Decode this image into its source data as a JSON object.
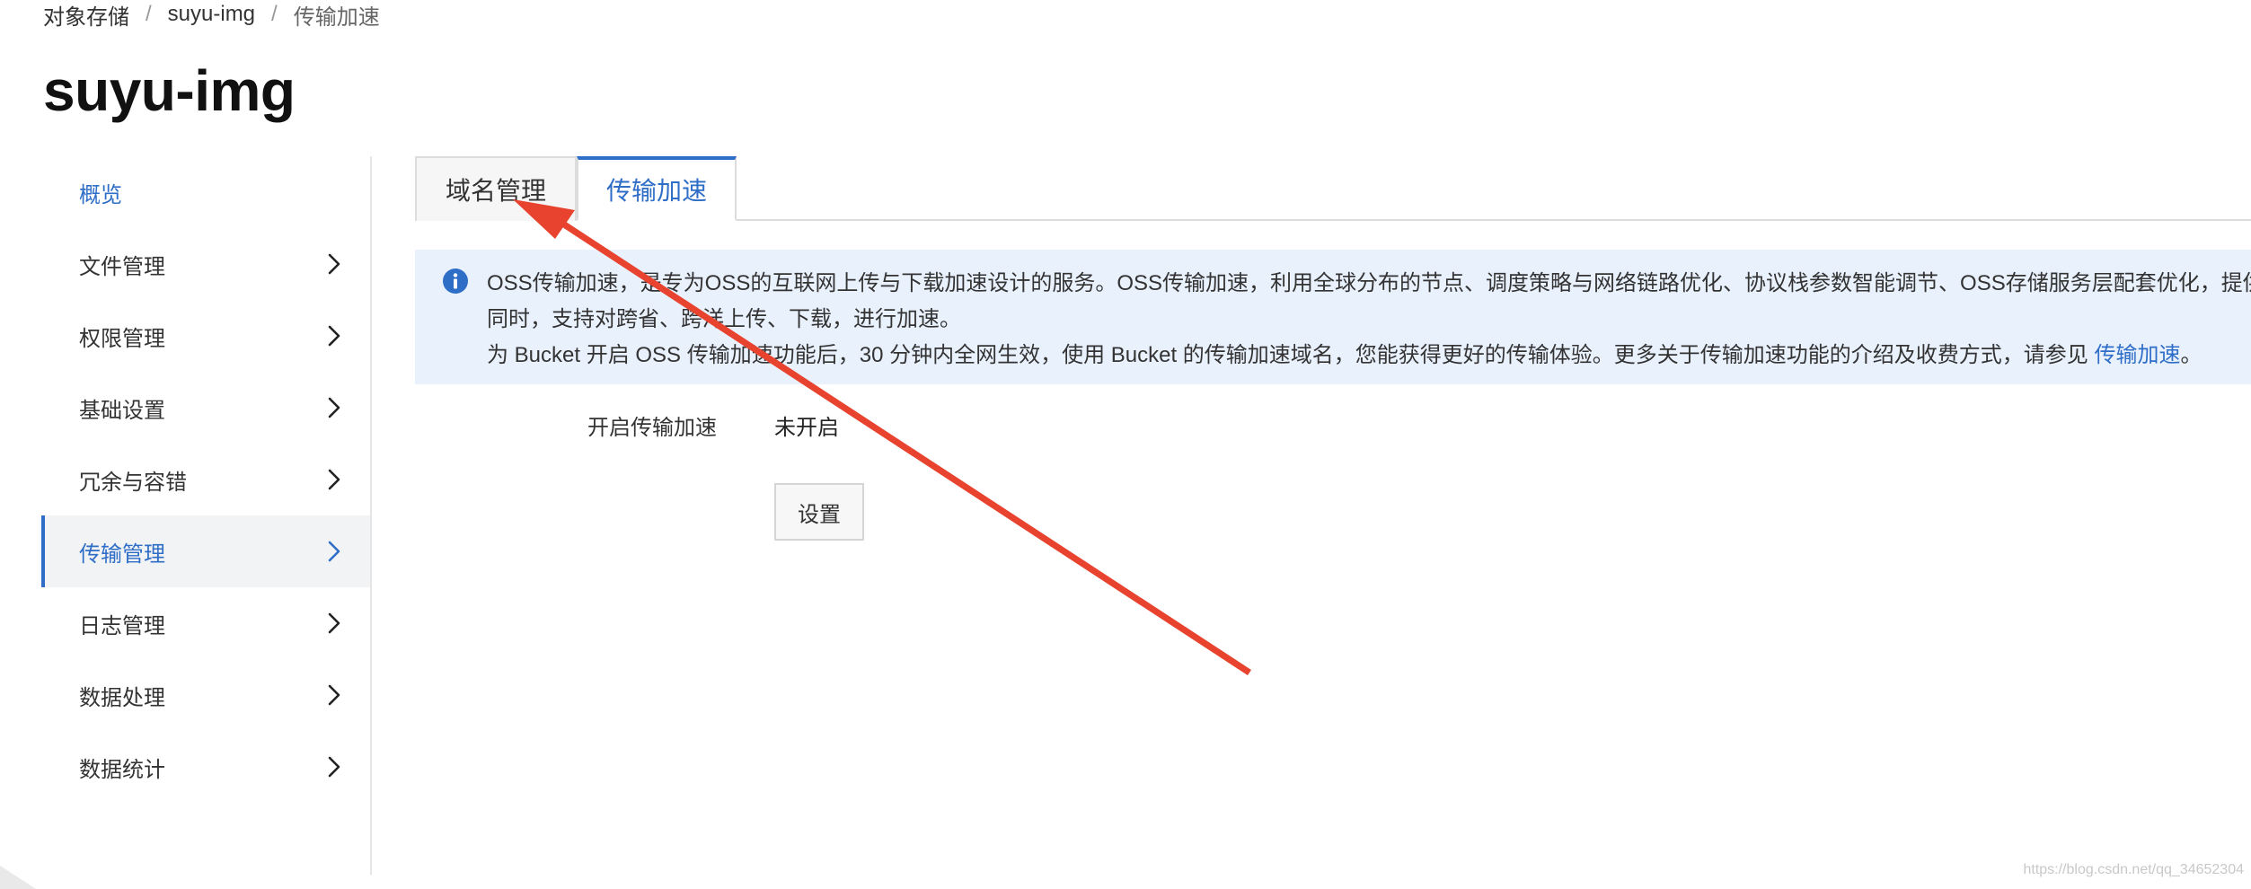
{
  "breadcrumb": {
    "items": [
      "对象存储",
      "suyu-img",
      "传输加速"
    ],
    "separator": "/"
  },
  "page_title": "suyu-img",
  "sidebar": {
    "items": [
      {
        "label": "概览"
      },
      {
        "label": "文件管理"
      },
      {
        "label": "权限管理"
      },
      {
        "label": "基础设置"
      },
      {
        "label": "冗余与容错"
      },
      {
        "label": "传输管理"
      },
      {
        "label": "日志管理"
      },
      {
        "label": "数据处理"
      },
      {
        "label": "数据统计"
      }
    ]
  },
  "tabs": [
    {
      "label": "域名管理"
    },
    {
      "label": "传输加速"
    }
  ],
  "notice": {
    "line1": "OSS传输加速，是专为OSS的互联网上传与下载加速设计的服务。OSS传输加速，利用全球分布的节点、调度策略与网络链路优化、协议栈参数智能调节、OSS存储服务层配套优化，提供",
    "line2": "同时，支持对跨省、跨洋上传、下载，进行加速。",
    "line3": "为 Bucket 开启 OSS 传输加速功能后，30 分钟内全网生效，使用 Bucket 的传输加速域名，您能获得更好的传输体验。更多关于传输加速功能的介绍及收费方式，请参见 ",
    "link": "传输加速",
    "line3_end": "。"
  },
  "setting": {
    "label": "开启传输加速",
    "value": "未开启",
    "button_label": "设置"
  },
  "watermark": "https://blog.csdn.net/qq_34652304",
  "colors": {
    "accent": "#2f6ec7",
    "arrow": "#e8432e",
    "notice_bg": "#e9f1fd"
  },
  "icons": {
    "chevron": "chevron-right-icon",
    "info": "info-icon"
  }
}
